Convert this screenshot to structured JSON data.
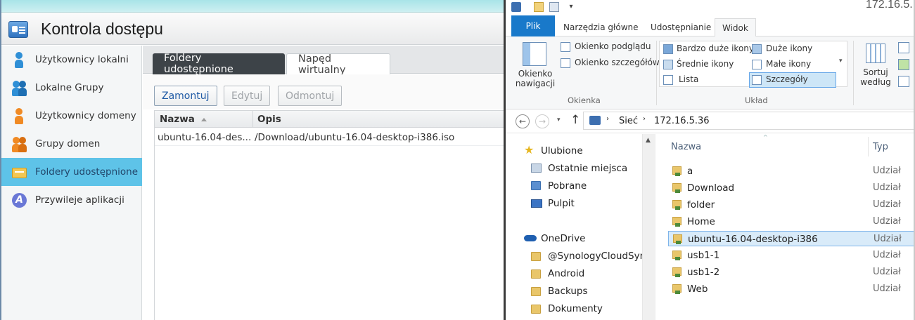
{
  "dsm": {
    "title": "Kontrola dostępu",
    "sidebar": [
      {
        "label": "Użytkownicy lokalni",
        "icon": "user-icon"
      },
      {
        "label": "Lokalne Grupy",
        "icon": "group-icon"
      },
      {
        "label": "Użytkownicy domeny",
        "icon": "domain-user-icon"
      },
      {
        "label": "Grupy domen",
        "icon": "domain-group-icon"
      },
      {
        "label": "Foldery udostępnione",
        "icon": "shared-folder-icon",
        "active": true
      },
      {
        "label": "Przywileje aplikacji",
        "icon": "app-privilege-icon"
      }
    ],
    "tabs": [
      "Foldery udostępnione",
      "Napęd wirtualny"
    ],
    "toolbar": {
      "mount": "Zamontuj",
      "edit": "Edytuj",
      "unmount": "Odmontuj"
    },
    "grid": {
      "columns": [
        "Nazwa",
        "Opis"
      ],
      "rows": [
        {
          "name": "ubuntu-16.04-des...",
          "desc": "/Download/ubuntu-16.04-desktop-i386.iso"
        }
      ]
    },
    "colors": {
      "active_item": "#5ec3e8",
      "tab_dark": "#3d4348",
      "accent": "#1f5aa5"
    }
  },
  "explorer": {
    "title_fragment": "172.16.5.",
    "ribbon_tabs": [
      "Plik",
      "Narzędzia główne",
      "Udostępnianie",
      "Widok"
    ],
    "panes": {
      "nav_pane": "Okienko\nnawigacji",
      "preview": "Okienko podglądu",
      "details": "Okienko szczegółów",
      "group_label": "Okienka"
    },
    "layout": {
      "extra_large": "Bardzo duże ikony",
      "large": "Duże ikony",
      "medium": "Średnie ikony",
      "small": "Małe ikony",
      "list": "Lista",
      "details": "Szczegóły",
      "group_label": "Układ"
    },
    "sort": "Sortuj\nwedług",
    "address": {
      "root": "Sieć",
      "host": "172.16.5.36"
    },
    "nav": {
      "favorites": "Ulubione",
      "favorites_items": [
        "Ostatnie miejsca",
        "Pobrane",
        "Pulpit"
      ],
      "onedrive": "OneDrive",
      "onedrive_items": [
        "@SynologyCloudSync",
        "Android",
        "Backups",
        "Dokumenty"
      ]
    },
    "list": {
      "col_name": "Nazwa",
      "col_type": "Typ",
      "items": [
        {
          "name": "a",
          "type": "Udział"
        },
        {
          "name": "Download",
          "type": "Udział"
        },
        {
          "name": "folder",
          "type": "Udział"
        },
        {
          "name": "Home",
          "type": "Udział"
        },
        {
          "name": "ubuntu-16.04-desktop-i386",
          "type": "Udział",
          "selected": true
        },
        {
          "name": "usb1-1",
          "type": "Udział"
        },
        {
          "name": "usb1-2",
          "type": "Udział"
        },
        {
          "name": "Web",
          "type": "Udział"
        }
      ]
    },
    "colors": {
      "file_tab": "#1979ca",
      "selection": "#d9ebf9"
    }
  }
}
